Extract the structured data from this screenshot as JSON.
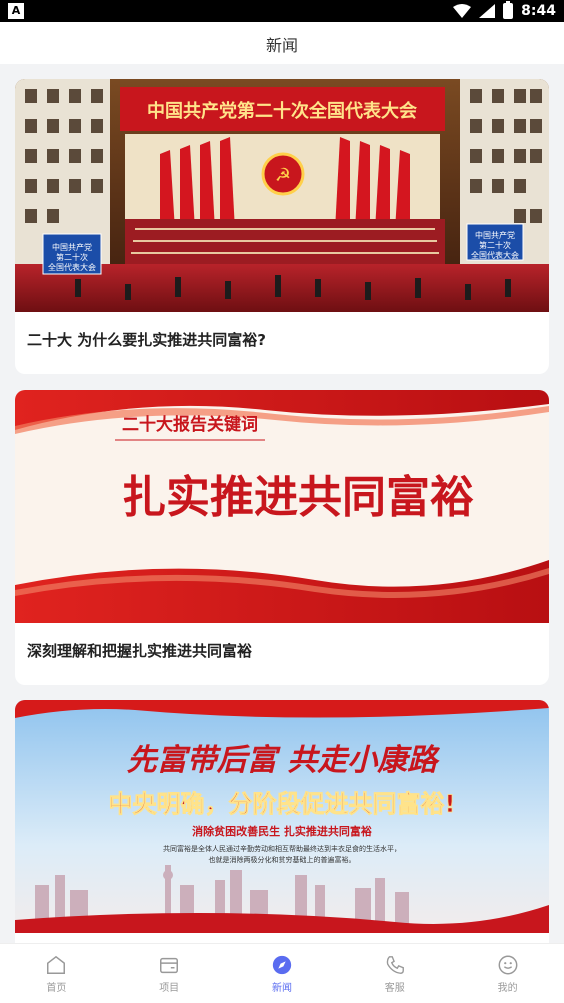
{
  "status": {
    "time": "8:44",
    "app_badge": "A"
  },
  "header": {
    "title": "新闻"
  },
  "cards": [
    {
      "title": "二十大 为什么要扎实推进共同富裕?",
      "image": {
        "banner": "中国共产党第二十次全国代表大会",
        "left_sign": "中国共产党\n第二十次\n全国代表大会",
        "right_sign": "中国共产党\n第二十次\n全国代表大会"
      }
    },
    {
      "title": "深刻理解和把握扎实推进共同富裕",
      "image": {
        "tag": "二十大报告关键词",
        "headline": "扎实推进共同富裕"
      }
    },
    {
      "title": "",
      "image": {
        "calligraphy": "先富带后富  共走小康路",
        "headline": "中央明确，分阶段促进共同富裕!",
        "sub": "消除贫困改善民生 扎实推进共同富裕",
        "body1": "共同富裕是全体人民通过辛勤劳动和相互帮助最终达到丰衣足食的生活水平，",
        "body2": "也就是消除两极分化和贫穷基础上的普遍富裕。"
      }
    }
  ],
  "tabs": [
    {
      "label": "首页",
      "icon": "home-icon",
      "active": false
    },
    {
      "label": "项目",
      "icon": "wallet-icon",
      "active": false
    },
    {
      "label": "新闻",
      "icon": "compass-icon",
      "active": true
    },
    {
      "label": "客服",
      "icon": "phone-icon",
      "active": false
    },
    {
      "label": "我的",
      "icon": "smile-icon",
      "active": false
    }
  ],
  "colors": {
    "accent": "#5a6cf0",
    "red": "#c8161d"
  }
}
